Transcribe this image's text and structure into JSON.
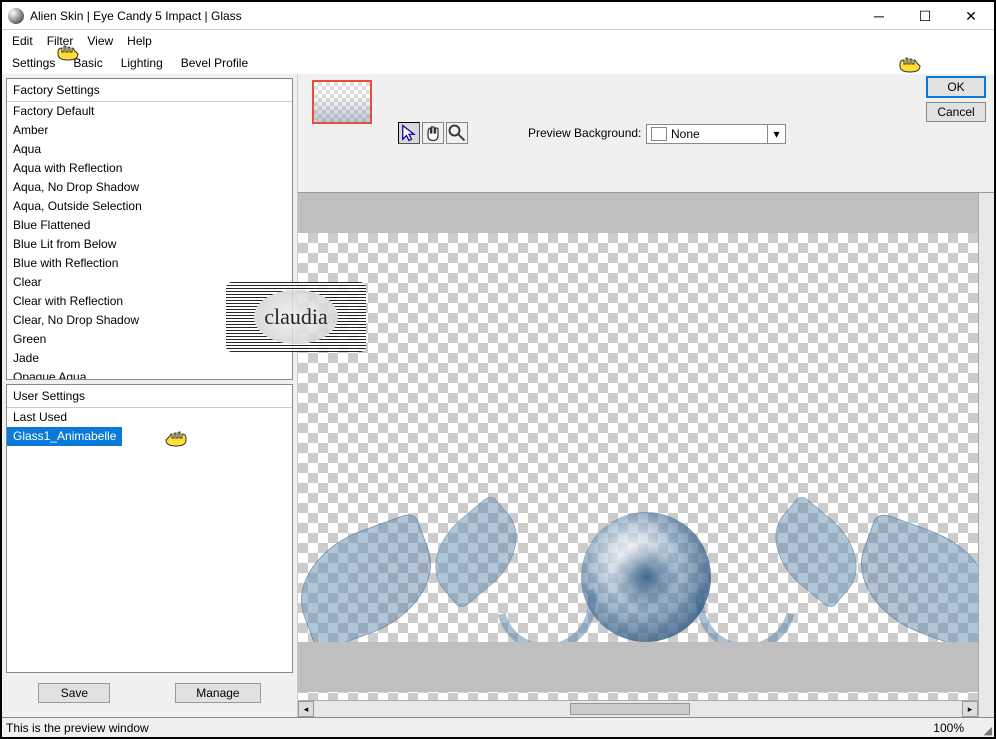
{
  "title": "Alien Skin | Eye Candy 5 Impact | Glass",
  "menu": {
    "edit": "Edit",
    "filter": "Filter",
    "view": "View",
    "help": "Help"
  },
  "tabs": {
    "settings": "Settings",
    "basic": "Basic",
    "lighting": "Lighting",
    "bevel": "Bevel Profile"
  },
  "factory": {
    "header": "Factory Settings",
    "items": [
      "Factory Default",
      "Amber",
      "Aqua",
      "Aqua with Reflection",
      "Aqua, No Drop Shadow",
      "Aqua, Outside Selection",
      "Blue Flattened",
      "Blue Lit from Below",
      "Blue with Reflection",
      "Clear",
      "Clear with Reflection",
      "Clear, No Drop Shadow",
      "Green",
      "Jade",
      "Opaque Aqua"
    ]
  },
  "user": {
    "header": "User Settings",
    "items": [
      "Last Used",
      "Glass1_Animabelle"
    ],
    "selected_index": 1
  },
  "buttons": {
    "save": "Save",
    "manage": "Manage",
    "ok": "OK",
    "cancel": "Cancel"
  },
  "preview": {
    "bg_label": "Preview Background:",
    "bg_value": "None"
  },
  "status": {
    "text": "This is the preview window",
    "zoom": "100%"
  },
  "watermark": "claudia"
}
